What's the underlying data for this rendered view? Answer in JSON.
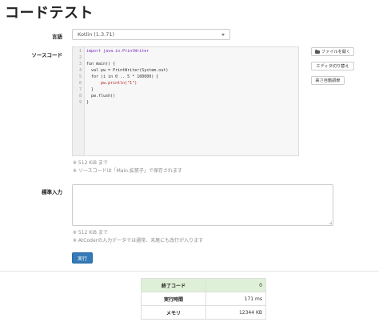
{
  "page_title": "コードテスト",
  "language": {
    "label": "言語",
    "selected": "Kotlin (1.3.71)"
  },
  "source": {
    "label": "ソースコード",
    "line_numbers": [
      "1",
      "2",
      "3",
      "4",
      "5",
      "6",
      "7",
      "8",
      "9"
    ],
    "code_lines": [
      "import java.io.PrintWriter",
      "",
      "fun main() {",
      "  val pw = PrintWriter(System.out)",
      "  for (i in 0 .. 5 * 100000) {",
      "      pw.println(\"1\")",
      "  }",
      "  pw.flush()",
      "}"
    ],
    "help_size": "※ 512 KiB まで",
    "help_save": "※ ソースコードは「Main.拡張子」で保存されます"
  },
  "side_buttons": {
    "open_file": "ファイルを開く",
    "toggle_editor": "エディタ切り替え",
    "auto_height": "高さ自動調節"
  },
  "stdin": {
    "label": "標準入力",
    "value": "",
    "help_size": "※ 512 KiB まで",
    "help_newline": "※ AtCoderの入力データでは通常、末尾にも改行が入ります"
  },
  "run_button": "実行",
  "results": [
    {
      "label": "終了コード",
      "value": "0"
    },
    {
      "label": "実行時間",
      "value": "171 ms"
    },
    {
      "label": "メモリ",
      "value": "12344 KB"
    }
  ],
  "colors": {
    "primary": "#337ab7",
    "success_row": "#dff0d8",
    "help_text": "#8a8a8a"
  },
  "icons": {
    "open_file": "folder-open-icon",
    "select_caret": "chevron-down-icon"
  }
}
